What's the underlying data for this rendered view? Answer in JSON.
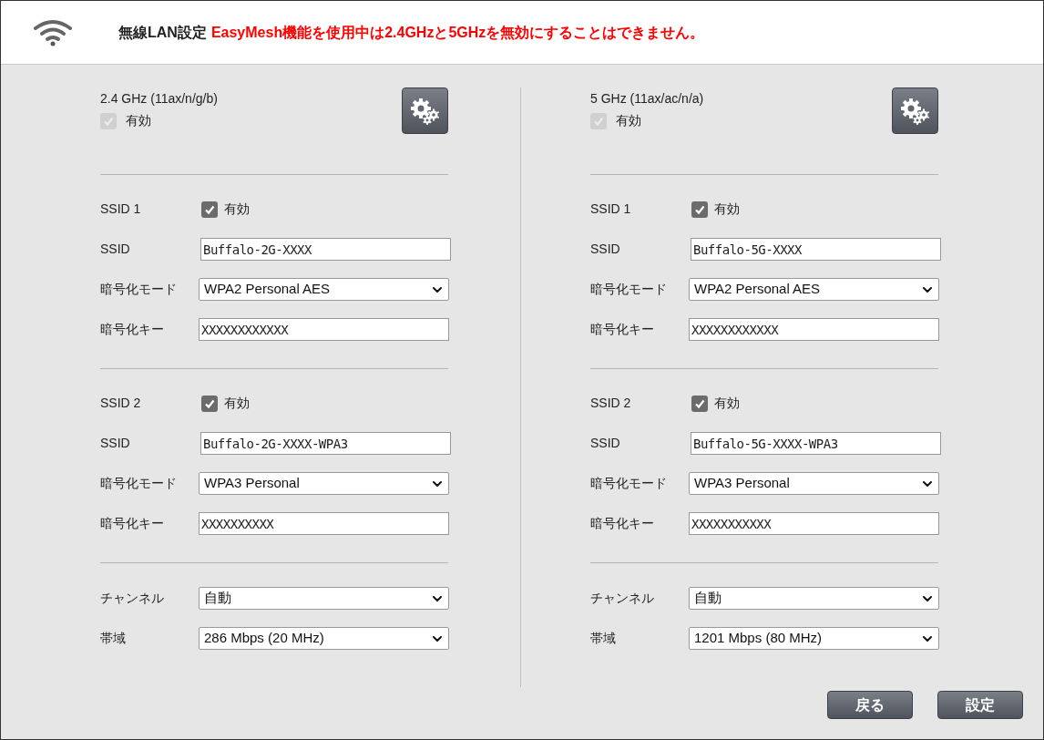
{
  "header": {
    "title": "無線LAN設定",
    "warning": "EasyMesh機能を使用中は2.4GHzと5GHzを無効にすることはできません。"
  },
  "bands": [
    {
      "title": "2.4 GHz (11ax/n/g/b)",
      "enable_label": "有効",
      "enabled": true,
      "enable_disabled": true,
      "ssids": [
        {
          "label": "SSID 1",
          "enable_label": "有効",
          "checked": true,
          "ssid_label": "SSID",
          "ssid": "Buffalo-2G-XXXX",
          "mode_label": "暗号化モード",
          "mode": "WPA2 Personal AES",
          "key_label": "暗号化キー",
          "key": "XXXXXXXXXXXX"
        },
        {
          "label": "SSID 2",
          "enable_label": "有効",
          "checked": true,
          "ssid_label": "SSID",
          "ssid": "Buffalo-2G-XXXX-WPA3",
          "mode_label": "暗号化モード",
          "mode": "WPA3 Personal",
          "key_label": "暗号化キー",
          "key": "XXXXXXXXXX"
        }
      ],
      "channel_label": "チャンネル",
      "channel": "自動",
      "width_label": "帯域",
      "width": "286 Mbps (20 MHz)"
    },
    {
      "title": "5 GHz (11ax/ac/n/a)",
      "enable_label": "有効",
      "enabled": true,
      "enable_disabled": true,
      "ssids": [
        {
          "label": "SSID 1",
          "enable_label": "有効",
          "checked": true,
          "ssid_label": "SSID",
          "ssid": "Buffalo-5G-XXXX",
          "mode_label": "暗号化モード",
          "mode": "WPA2 Personal AES",
          "key_label": "暗号化キー",
          "key": "XXXXXXXXXXXX"
        },
        {
          "label": "SSID 2",
          "enable_label": "有効",
          "checked": true,
          "ssid_label": "SSID",
          "ssid": "Buffalo-5G-XXXX-WPA3",
          "mode_label": "暗号化モード",
          "mode": "WPA3 Personal",
          "key_label": "暗号化キー",
          "key": "XXXXXXXXXXX"
        }
      ],
      "channel_label": "チャンネル",
      "channel": "自動",
      "width_label": "帯域",
      "width": "1201 Mbps (80 MHz)"
    }
  ],
  "buttons": [
    "戻る",
    "設定"
  ]
}
